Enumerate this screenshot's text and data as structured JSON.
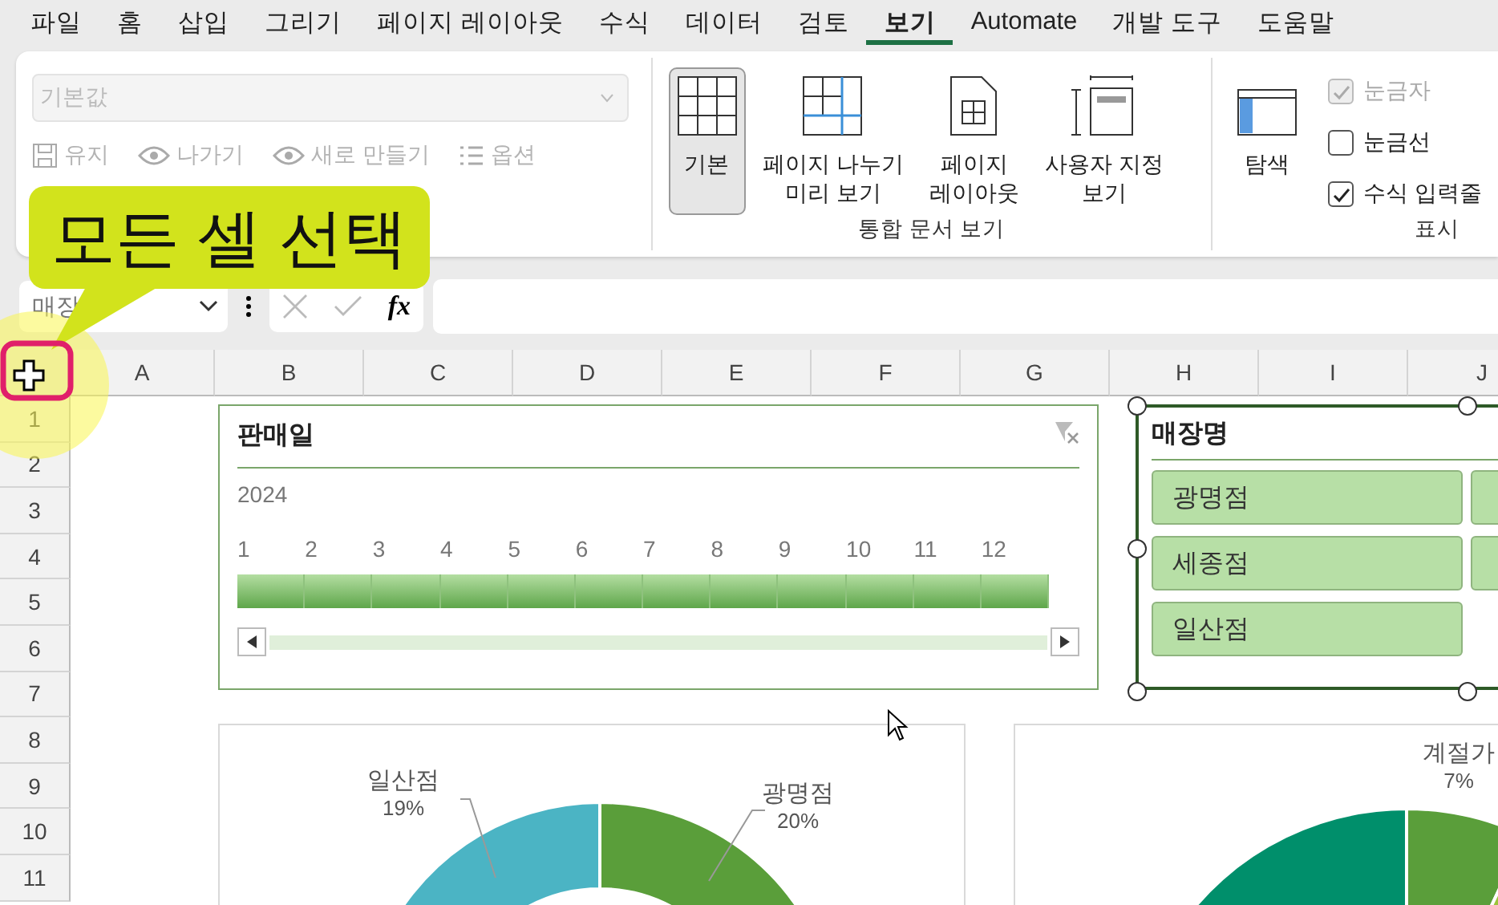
{
  "menu_tabs": [
    {
      "label": "파일",
      "selected": false
    },
    {
      "label": "홈",
      "selected": false
    },
    {
      "label": "삽입",
      "selected": false
    },
    {
      "label": "그리기",
      "selected": false
    },
    {
      "label": "페이지 레이아웃",
      "selected": false
    },
    {
      "label": "수식",
      "selected": false
    },
    {
      "label": "데이터",
      "selected": false
    },
    {
      "label": "검토",
      "selected": false
    },
    {
      "label": "보기",
      "selected": true
    },
    {
      "label": "Automate",
      "selected": false
    },
    {
      "label": "개발 도구",
      "selected": false
    },
    {
      "label": "도움말",
      "selected": false
    }
  ],
  "ribbon": {
    "sheet_view": {
      "dropdown_value": "기본값",
      "disabled": true,
      "buttons": [
        {
          "kind": "keep",
          "label": "유지"
        },
        {
          "kind": "exit",
          "label": "나가기"
        },
        {
          "kind": "new",
          "label": "새로 만들기"
        },
        {
          "kind": "options",
          "label": "옵션"
        }
      ]
    },
    "workbook_views": {
      "title": "통합 문서 보기",
      "buttons": [
        {
          "kind": "normal",
          "label": "기본",
          "selected": true
        },
        {
          "kind": "pagebreak",
          "label": "페이지 나누기\n미리 보기",
          "selected": false
        },
        {
          "kind": "layout",
          "label": "페이지\n레이아웃",
          "selected": false
        },
        {
          "kind": "custom",
          "label": "사용자 지정\n보기",
          "selected": false
        }
      ]
    },
    "show": {
      "title": "표시",
      "navigation": "탐색",
      "checks": [
        {
          "label": "눈금자",
          "checked": true,
          "disabled": true
        },
        {
          "label": "눈금선",
          "checked": false,
          "disabled": false
        },
        {
          "label": "수식 입력줄",
          "checked": true,
          "disabled": false
        }
      ]
    }
  },
  "callout": "모든 셀 선택",
  "formula_bar": {
    "name_box": "매장",
    "fx": "fx"
  },
  "columns": [
    "A",
    "B",
    "C",
    "D",
    "E",
    "F",
    "G",
    "H",
    "I",
    "J"
  ],
  "rows": [
    "1",
    "2",
    "3",
    "4",
    "5",
    "6",
    "7",
    "8",
    "9",
    "10",
    "11"
  ],
  "timeline": {
    "title": "판매일",
    "year": "2024",
    "months": [
      {
        "label": "1",
        "selected": true
      },
      {
        "label": "2",
        "selected": true
      },
      {
        "label": "3",
        "selected": true
      },
      {
        "label": "4",
        "selected": true
      },
      {
        "label": "5",
        "selected": true
      },
      {
        "label": "6",
        "selected": true
      },
      {
        "label": "7",
        "selected": true
      },
      {
        "label": "8",
        "selected": true
      },
      {
        "label": "9",
        "selected": true
      },
      {
        "label": "10",
        "selected": true
      },
      {
        "label": "11",
        "selected": true
      },
      {
        "label": "12",
        "selected": true
      }
    ]
  },
  "store_slicer": {
    "title": "매장명",
    "items": [
      {
        "kind": "full",
        "label": "광명점",
        "selected": true
      },
      {
        "kind": "cut",
        "selected": true
      },
      {
        "kind": "full",
        "label": "세종점",
        "selected": true
      },
      {
        "kind": "cut",
        "selected": true
      },
      {
        "kind": "full",
        "label": "일산점",
        "selected": true
      }
    ]
  },
  "charts": [
    {
      "labels": [
        {
          "name": "일산점",
          "value": "19%"
        },
        {
          "name": "광명점",
          "value": "20%"
        }
      ]
    },
    {
      "labels": [
        {
          "name": "계절가",
          "value": "7%"
        }
      ]
    }
  ]
}
